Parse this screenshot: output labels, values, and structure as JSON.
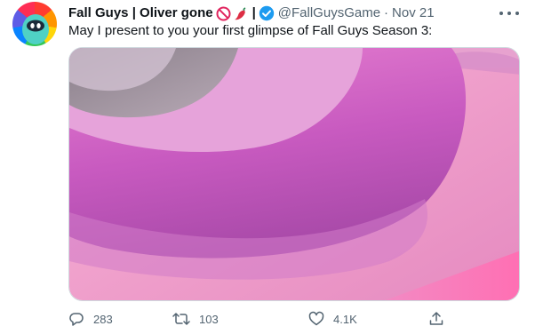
{
  "tweet": {
    "display_name": "Fall Guys | Oliver gone",
    "name_emojis": [
      "prohibited-emoji",
      "chili-pepper-emoji"
    ],
    "pipe": "|",
    "handle": "@FallGuysGame",
    "separator": "·",
    "timestamp": "Nov 21",
    "text": "May I present to you your first glimpse of Fall Guys Season 3:",
    "verified": true,
    "avatar": "fall-guys-bean-avatar",
    "media": "video-still-pink-bean-closeup",
    "actions": {
      "reply_count": "283",
      "retweet_count": "103",
      "like_count": "4.1K"
    }
  },
  "colors": {
    "text_primary": "#0f1419",
    "text_secondary": "#536471",
    "verified_blue": "#1d9bf0",
    "media_border": "#cfd9de"
  },
  "icons": {
    "more": "more-dots-icon",
    "reply": "reply-icon",
    "retweet": "retweet-icon",
    "like": "heart-icon",
    "share": "share-icon",
    "verified": "verified-badge-icon"
  }
}
